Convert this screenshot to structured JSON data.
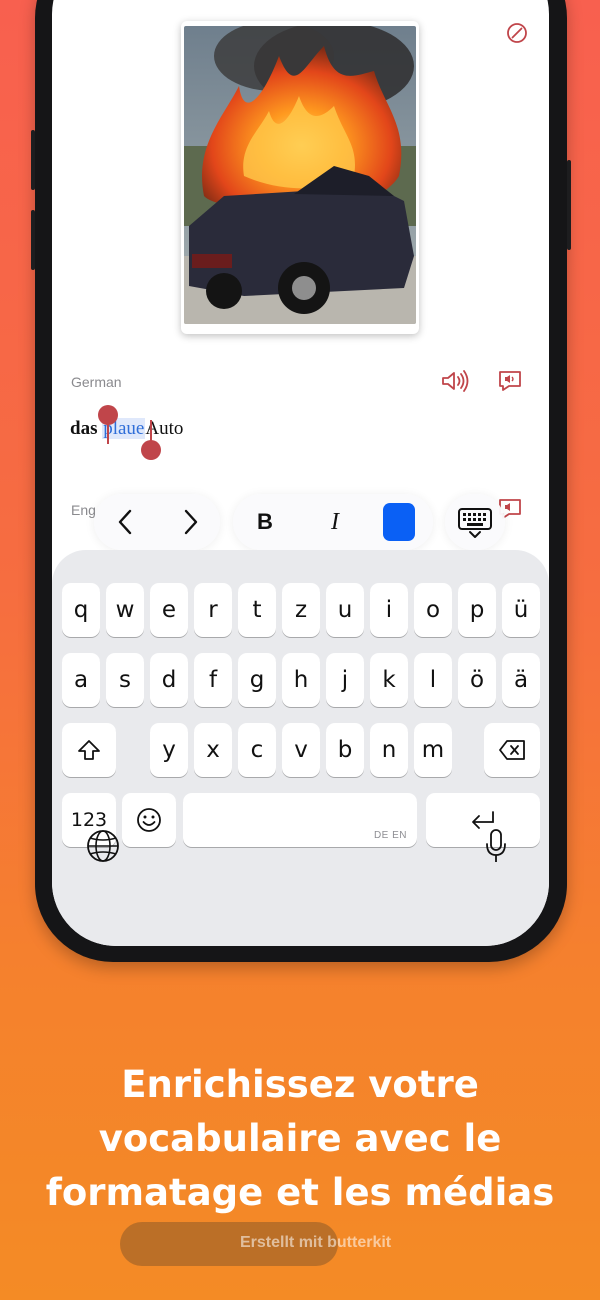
{
  "card": {
    "image_alt": "Burning car",
    "front_language": "German",
    "back_language": "Eng",
    "word": {
      "article": "das",
      "selected": "plaue",
      "rest": "Auto"
    }
  },
  "toolbar": {
    "bold_label": "B",
    "italic_label": "I",
    "color": "#0a60f5"
  },
  "keyboard": {
    "row1": [
      "q",
      "w",
      "e",
      "r",
      "t",
      "z",
      "u",
      "i",
      "o",
      "p",
      "ü"
    ],
    "row2": [
      "a",
      "s",
      "d",
      "f",
      "g",
      "h",
      "j",
      "k",
      "l",
      "ö",
      "ä"
    ],
    "row3": [
      "y",
      "x",
      "c",
      "v",
      "b",
      "n",
      "m"
    ],
    "numbers_label": "123",
    "space_hint": "DE EN"
  },
  "caption": {
    "line1": "Enrichissez votre",
    "line2": "vocabulaire avec le",
    "line3": "formatage et les médias"
  },
  "credit": "Erstellt mit butterkit"
}
